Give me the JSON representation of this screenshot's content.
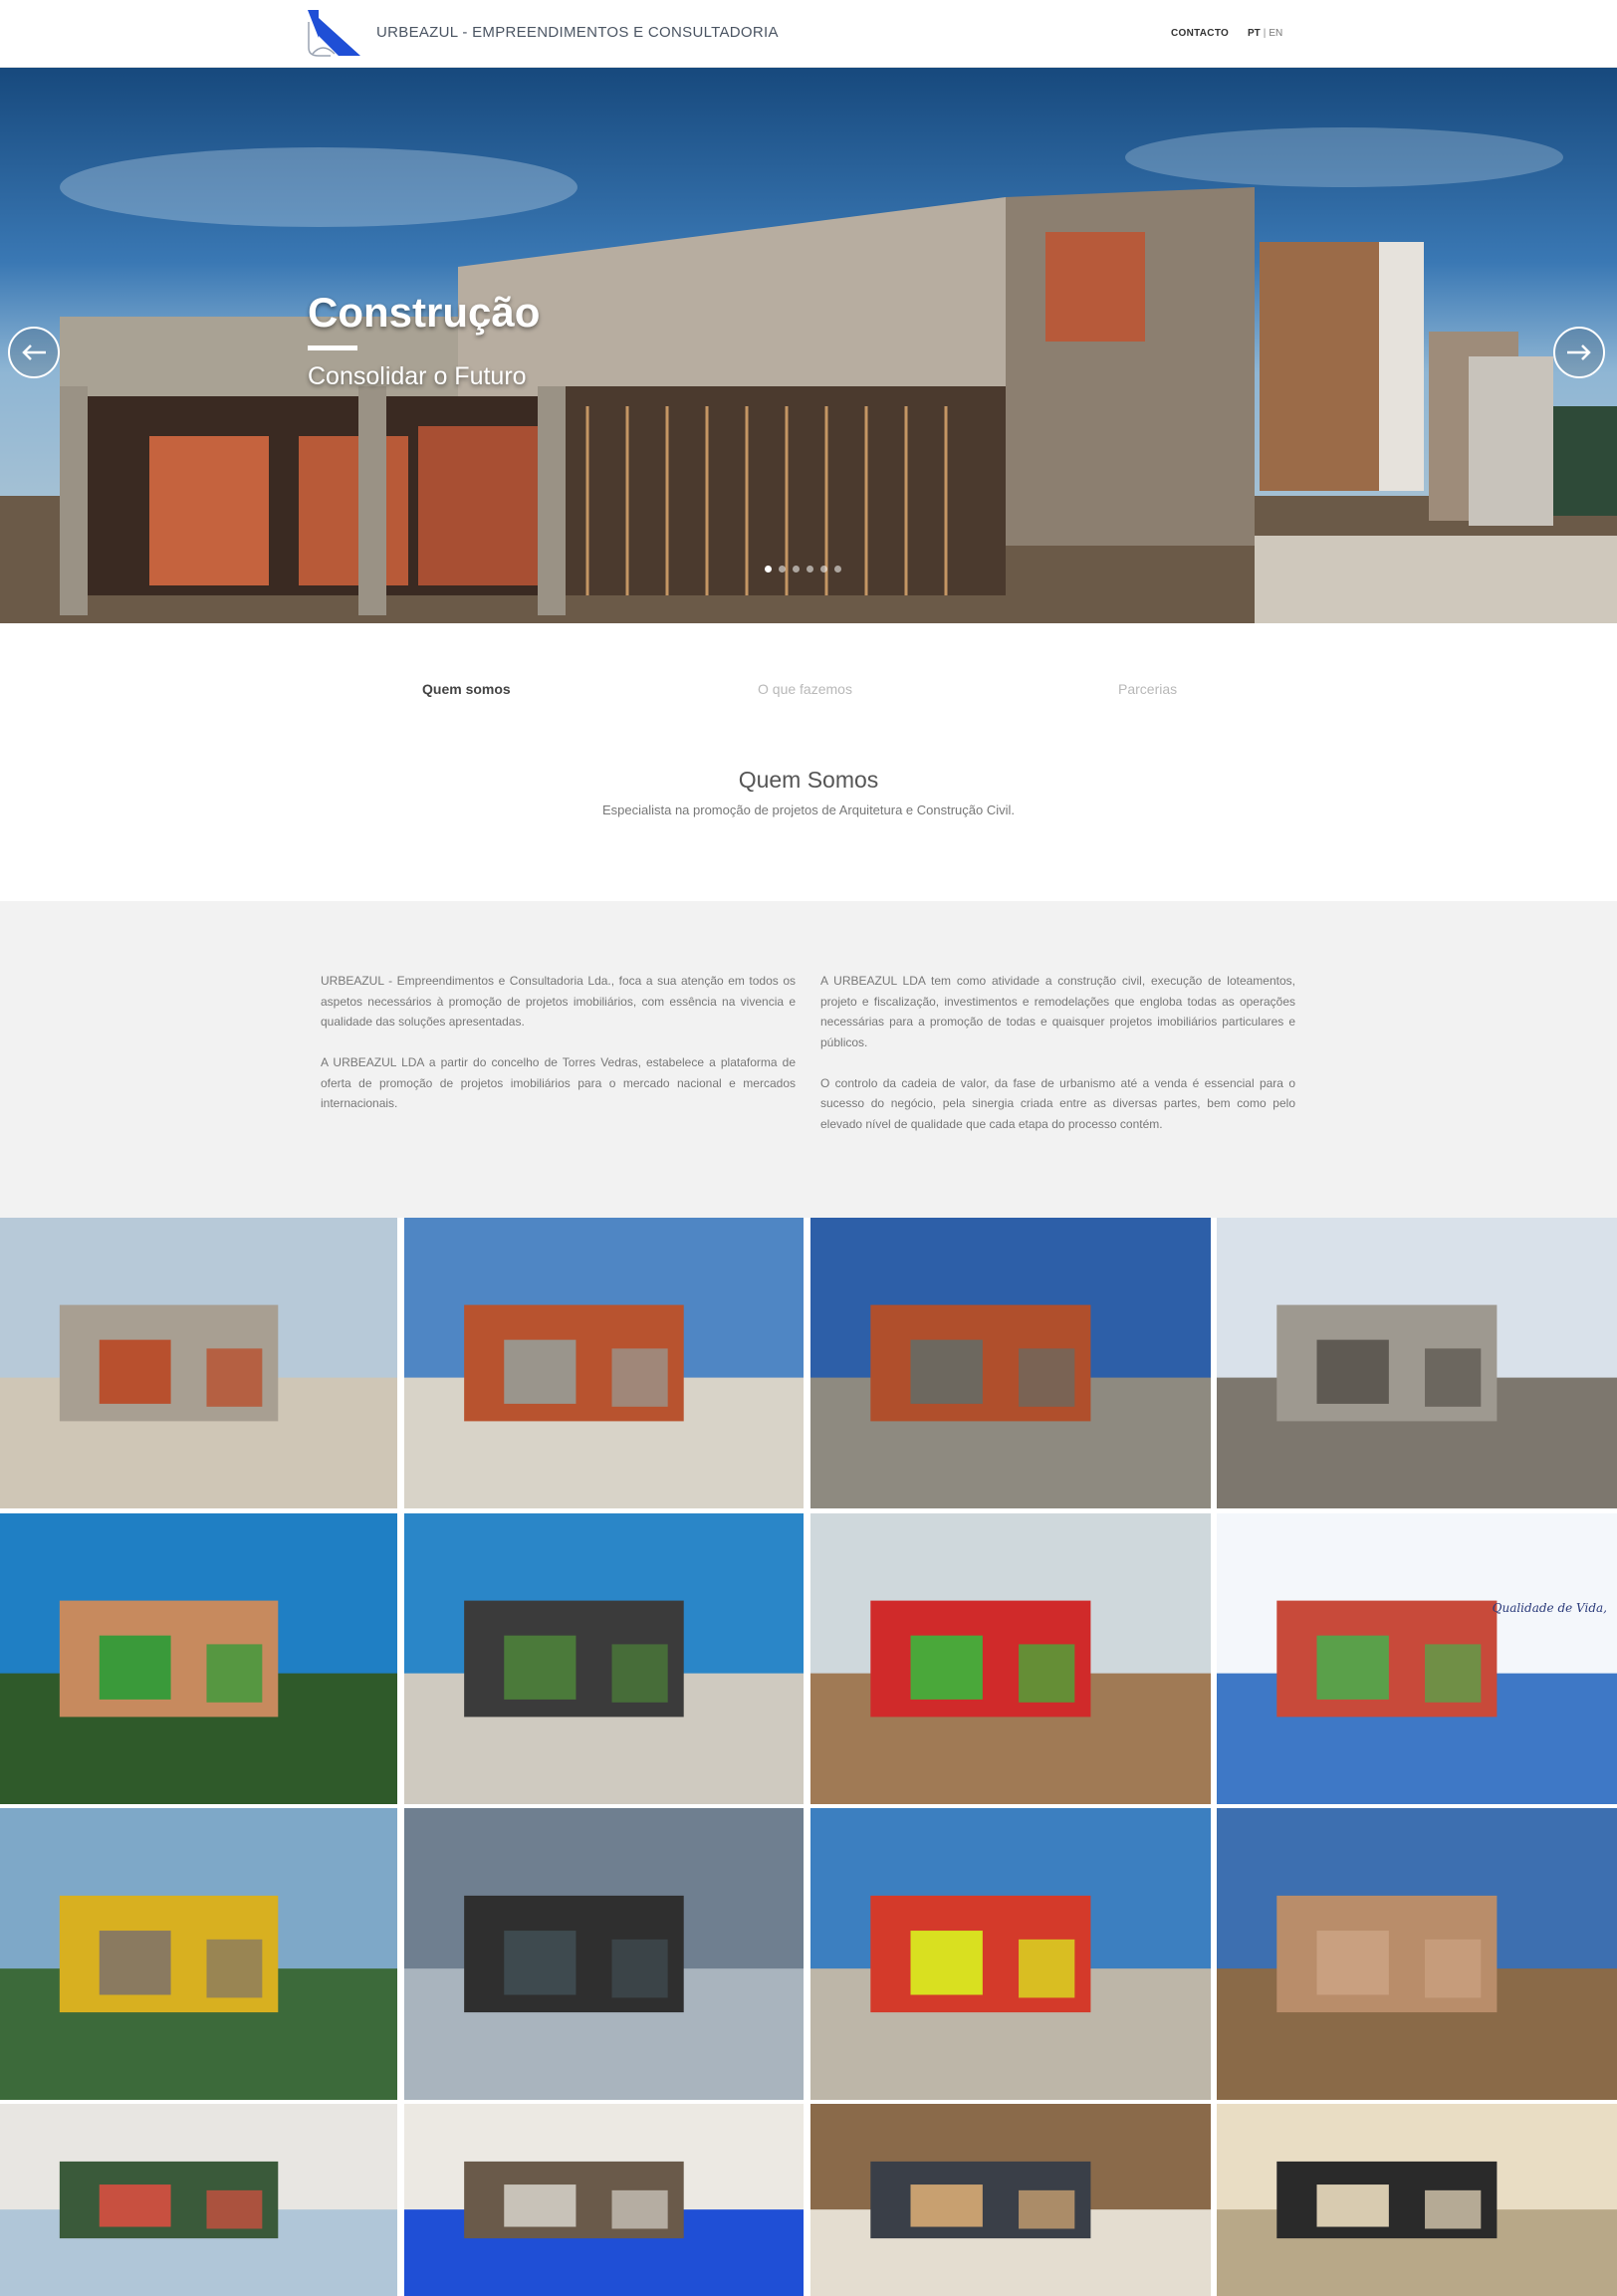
{
  "header": {
    "brand": "URBEAZUL - EMPREENDIMENTOS E CONSULTADORIA",
    "contact": "CONTACTO",
    "lang_pt": "PT",
    "lang_sep": "|",
    "lang_en": "EN"
  },
  "hero": {
    "title": "Construção",
    "subtitle": "Consolidar o Futuro",
    "slide_count": 6,
    "active_slide": 1
  },
  "tabs": [
    {
      "label": "Quem somos",
      "active": true
    },
    {
      "label": "O que fazemos",
      "active": false
    },
    {
      "label": "Parcerias",
      "active": false
    }
  ],
  "section": {
    "title": "Quem Somos",
    "subtitle": "Especialista na promoção de projetos de Arquitetura e Construção Civil."
  },
  "about": {
    "left": [
      "URBEAZUL - Empreendimentos e Consultadoria Lda., foca a sua atenção em todos os aspetos necessários à promoção de projetos imobiliários, com essência na vivencia e qualidade das soluções apresentadas.",
      "A URBEAZUL LDA a partir do concelho de Torres Vedras, estabelece a plataforma de oferta de promoção de projetos imobiliários para o mercado nacional e mercados internacionais."
    ],
    "right": [
      "A URBEAZUL LDA tem como atividade a construção civil, execução de loteamentos, projeto e fiscalização, investimentos e remodelações que engloba todas as operações necessárias para a promoção de todas e quaisquer projetos imobiliários particulares e públicos.",
      "O controlo da cadeia de valor, da fase de urbanismo até a venda é essencial para o sucesso do negócio, pela sinergia criada entre as diversas partes, bem como pelo elevado nível de qualidade que cada etapa do processo contém."
    ]
  },
  "gallery": {
    "tiles": [
      {
        "name": "house-construction-hill-photo"
      },
      {
        "name": "brick-walls-street-photo"
      },
      {
        "name": "concrete-frame-building-photo"
      },
      {
        "name": "stone-house-worker-photo"
      },
      {
        "name": "pine-trees-playground-photo"
      },
      {
        "name": "new-road-street-lamps-photo"
      },
      {
        "name": "playground-slide-photo"
      },
      {
        "name": "qualidade-de-vida-brochure"
      },
      {
        "name": "excavator-arm-photo"
      },
      {
        "name": "tower-crane-clouds-photo"
      },
      {
        "name": "ladder-worker-wall-photo"
      },
      {
        "name": "earthworks-site-photo"
      },
      {
        "name": "project-plans-binder-photo"
      },
      {
        "name": "urbeazul-folders-photo"
      },
      {
        "name": "meeting-table-photo"
      },
      {
        "name": "pen-on-drawings-photo"
      }
    ],
    "brochure_heading": "Qualidade de Vida,"
  },
  "colors": {
    "brand_blue": "#1f4fd6",
    "band_grey": "#f2f2f2",
    "text_grey": "#777777"
  }
}
